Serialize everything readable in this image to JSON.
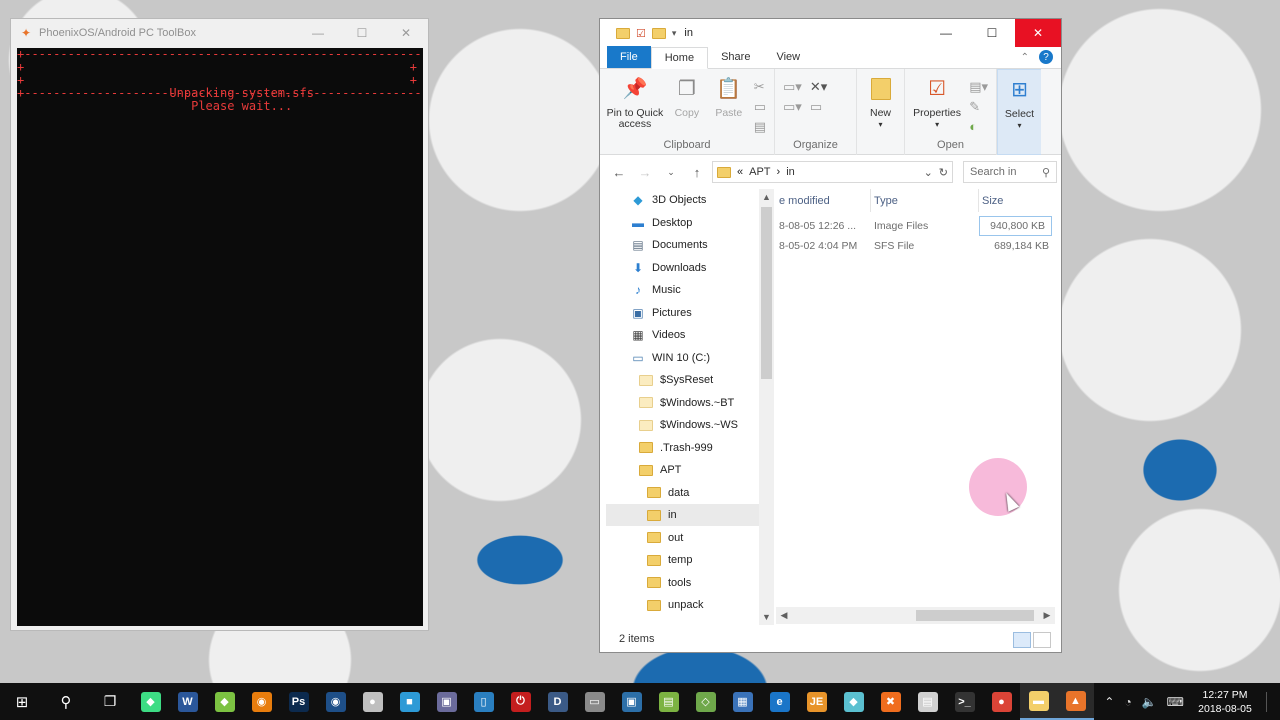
{
  "console": {
    "title": "PhoenixOS/Android PC ToolBox",
    "lines": {
      "rule": "+----------------------------------------------------------+",
      "line1": "Unpacking system.sfs",
      "line2": "Please wait...",
      "plus": "+"
    },
    "buttons": {
      "min": "—",
      "max": "☐",
      "close": "✕"
    }
  },
  "explorer": {
    "title": "in",
    "tabs": [
      "File",
      "Home",
      "Share",
      "View"
    ],
    "ribbon": {
      "pin_label": "Pin to Quick access",
      "copy_label": "Copy",
      "paste_label": "Paste",
      "clipboard_group": "Clipboard",
      "organize_group": "Organize",
      "new_label": "New",
      "properties_label": "Properties",
      "open_group": "Open",
      "select_label": "Select"
    },
    "address": {
      "prefix": "«",
      "crumbs": [
        "APT",
        "in"
      ],
      "search_placeholder": "Search in"
    },
    "nav": [
      {
        "label": "3D Objects",
        "icon": "cube-icon"
      },
      {
        "label": "Desktop",
        "icon": "desktop-icon"
      },
      {
        "label": "Documents",
        "icon": "documents-icon"
      },
      {
        "label": "Downloads",
        "icon": "download-arrow-icon"
      },
      {
        "label": "Music",
        "icon": "music-note-icon"
      },
      {
        "label": "Pictures",
        "icon": "pictures-icon"
      },
      {
        "label": "Videos",
        "icon": "videos-icon"
      },
      {
        "label": "WIN 10 (C:)",
        "icon": "drive-icon"
      },
      {
        "label": "$SysReset",
        "icon": "folder-icon"
      },
      {
        "label": "$Windows.~BT",
        "icon": "folder-icon"
      },
      {
        "label": "$Windows.~WS",
        "icon": "folder-icon"
      },
      {
        "label": ".Trash-999",
        "icon": "folder-icon"
      },
      {
        "label": "APT",
        "icon": "folder-icon"
      },
      {
        "label": "data",
        "icon": "folder-icon"
      },
      {
        "label": "in",
        "icon": "folder-icon"
      },
      {
        "label": "out",
        "icon": "folder-icon"
      },
      {
        "label": "temp",
        "icon": "folder-icon"
      },
      {
        "label": "tools",
        "icon": "folder-icon"
      },
      {
        "label": "unpack",
        "icon": "folder-icon"
      }
    ],
    "columns": {
      "modified": "e modified",
      "type": "Type",
      "size": "Size"
    },
    "files": [
      {
        "modified": "8-08-05 12:26 ...",
        "type": "Image Files",
        "size": "940,800 KB"
      },
      {
        "modified": "8-05-02 4:04 PM",
        "type": "SFS File",
        "size": "689,184 KB"
      }
    ],
    "status": "2 items"
  },
  "taskbar": {
    "apps": [
      {
        "name": "android-studio-icon",
        "glyph": "◆",
        "color": "#3ddc84"
      },
      {
        "name": "word-icon",
        "glyph": "W",
        "color": "#2b579a"
      },
      {
        "name": "brackets-icon",
        "glyph": "◆",
        "color": "#7cc242"
      },
      {
        "name": "blender-icon",
        "glyph": "◉",
        "color": "#e87d0d"
      },
      {
        "name": "photoshop-icon",
        "glyph": "Ps",
        "color": "#0c2a4e"
      },
      {
        "name": "media-icon",
        "glyph": "◉",
        "color": "#1e4f88"
      },
      {
        "name": "disc-icon",
        "glyph": "●",
        "color": "#bfbfbf"
      },
      {
        "name": "camera-icon",
        "glyph": "■",
        "color": "#2d9ad6"
      },
      {
        "name": "virtualbox-icon",
        "glyph": "▣",
        "color": "#6b6b9b"
      },
      {
        "name": "bracket-app-icon",
        "glyph": "▯",
        "color": "#2a7fc0"
      },
      {
        "name": "power-icon",
        "glyph": "⏻",
        "color": "#c41e1e"
      },
      {
        "name": "dev-icon",
        "glyph": "D",
        "color": "#3b5a86"
      },
      {
        "name": "window-icon",
        "glyph": "▭",
        "color": "#8a8a8a"
      },
      {
        "name": "vm-icon",
        "glyph": "▣",
        "color": "#2c6fa8"
      },
      {
        "name": "notepad-icon",
        "glyph": "▤",
        "color": "#7cb342"
      },
      {
        "name": "gem-icon",
        "glyph": "◇",
        "color": "#6fa84b"
      },
      {
        "name": "calculator-icon",
        "glyph": "▦",
        "color": "#3a72b8"
      },
      {
        "name": "edge-icon",
        "glyph": "e",
        "color": "#1a75c8"
      },
      {
        "name": "jetbrains-icon",
        "glyph": "JE",
        "color": "#e8942a"
      },
      {
        "name": "paint-icon",
        "glyph": "◆",
        "color": "#5bc0d0"
      },
      {
        "name": "xampp-icon",
        "glyph": "✖",
        "color": "#f06d1e"
      },
      {
        "name": "document-icon",
        "glyph": "▤",
        "color": "#d0d0d0"
      },
      {
        "name": "terminal-icon",
        "glyph": ">_",
        "color": "#333333"
      },
      {
        "name": "chrome-icon",
        "glyph": "●",
        "color": "#db4437"
      },
      {
        "name": "explorer-icon",
        "glyph": "▬",
        "color": "#f3cf6a"
      },
      {
        "name": "phoenix-icon",
        "glyph": "▲",
        "color": "#e8742a"
      }
    ],
    "clock": {
      "time": "12:27 PM",
      "date": "2018-08-05"
    }
  }
}
